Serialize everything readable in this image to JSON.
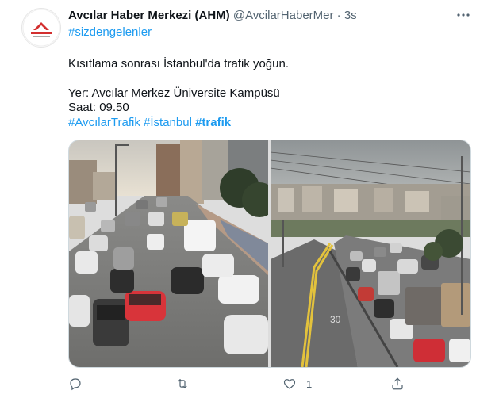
{
  "tweet": {
    "display_name": "Avcılar Haber Merkezi (AHM)",
    "handle": "@AvcilarHaberMer",
    "separator": "·",
    "time": "3s",
    "hashtag_top": "#sizdengelenler",
    "line1": "Kısıtlama sonrası İstanbul'da trafik yoğun.",
    "line2": "Yer: Avcılar Merkez Üniversite Kampüsü",
    "line3": "Saat: 09.50",
    "tag1": "#AvcılarTrafik",
    "tag2": "#İstanbul",
    "tag3": "#trafik",
    "like_count": "1"
  },
  "icons": {
    "avatar": "avatar-logo-icon",
    "more": "more-dots-icon",
    "reply": "reply-icon",
    "retweet": "retweet-icon",
    "like": "heart-icon",
    "share": "share-icon"
  },
  "colors": {
    "link": "#1d9bf0",
    "muted": "#536471",
    "text": "#0f1419",
    "logo_red": "#d32f2f"
  }
}
